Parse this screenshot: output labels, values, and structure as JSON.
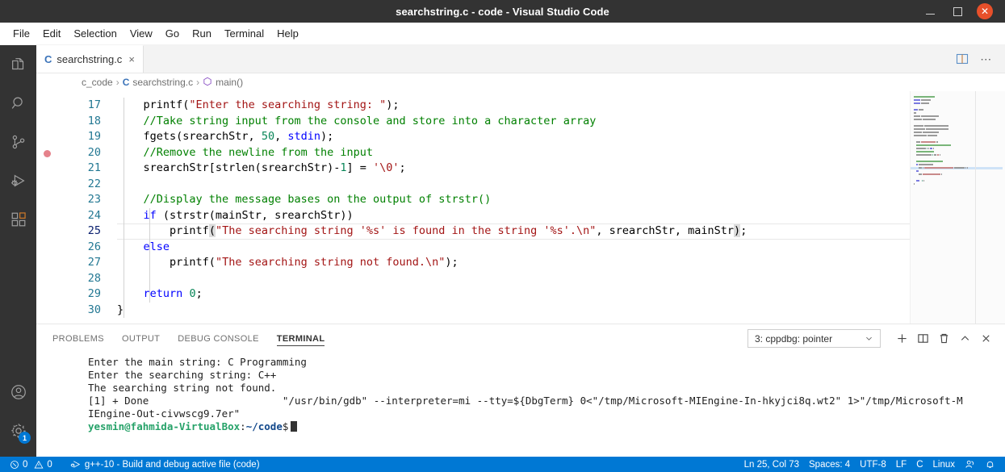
{
  "window": {
    "title": "searchstring.c - code - Visual Studio Code",
    "minimize_label": "Minimize",
    "maximize_label": "Maximize",
    "close_label": "Close"
  },
  "menubar": {
    "items": [
      "File",
      "Edit",
      "Selection",
      "View",
      "Go",
      "Run",
      "Terminal",
      "Help"
    ]
  },
  "activitybar": {
    "items": [
      {
        "name": "explorer",
        "title": "Explorer"
      },
      {
        "name": "search",
        "title": "Search"
      },
      {
        "name": "source-control",
        "title": "Source Control"
      },
      {
        "name": "run-debug",
        "title": "Run and Debug"
      },
      {
        "name": "extensions",
        "title": "Extensions"
      }
    ],
    "bottom": [
      {
        "name": "accounts",
        "title": "Accounts"
      },
      {
        "name": "settings",
        "title": "Manage",
        "badge": "1"
      }
    ]
  },
  "tabs": {
    "active": {
      "icon_letter": "C",
      "label": "searchstring.c",
      "close": "×"
    },
    "actions": [
      {
        "name": "split-editor-right",
        "title": "Split Editor Right"
      },
      {
        "name": "more-actions",
        "title": "More Actions..."
      }
    ]
  },
  "breadcrumb": {
    "folder": "c_code",
    "sep1": "›",
    "file_icon": "C",
    "file": "searchstring.c",
    "sep2": "›",
    "symbol": "main()"
  },
  "editor": {
    "first_line": 17,
    "breakpoint_line": 20,
    "current_line": 25,
    "lines": [
      {
        "n": 17,
        "tokens": [
          {
            "t": "    ",
            "c": ""
          },
          {
            "t": "printf(",
            "c": ""
          },
          {
            "t": "\"Enter the searching string: \"",
            "c": "str"
          },
          {
            "t": ");",
            "c": ""
          }
        ]
      },
      {
        "n": 18,
        "tokens": [
          {
            "t": "    ",
            "c": ""
          },
          {
            "t": "//Take string input from the console and store into a character array",
            "c": "cmt"
          }
        ]
      },
      {
        "n": 19,
        "tokens": [
          {
            "t": "    ",
            "c": ""
          },
          {
            "t": "fgets(srearchStr, ",
            "c": ""
          },
          {
            "t": "50",
            "c": "num"
          },
          {
            "t": ", ",
            "c": ""
          },
          {
            "t": "stdin",
            "c": "kw"
          },
          {
            "t": ");",
            "c": ""
          }
        ]
      },
      {
        "n": 20,
        "tokens": [
          {
            "t": "    ",
            "c": ""
          },
          {
            "t": "//Remove the newline from the input",
            "c": "cmt"
          }
        ]
      },
      {
        "n": 21,
        "tokens": [
          {
            "t": "    ",
            "c": ""
          },
          {
            "t": "srearchStr[strlen(srearchStr)-",
            "c": ""
          },
          {
            "t": "1",
            "c": "num"
          },
          {
            "t": "] = ",
            "c": ""
          },
          {
            "t": "'\\0'",
            "c": "str"
          },
          {
            "t": ";",
            "c": ""
          }
        ]
      },
      {
        "n": 22,
        "tokens": []
      },
      {
        "n": 23,
        "tokens": [
          {
            "t": "    ",
            "c": ""
          },
          {
            "t": "//Display the message bases on the output of strstr()",
            "c": "cmt"
          }
        ]
      },
      {
        "n": 24,
        "tokens": [
          {
            "t": "    ",
            "c": ""
          },
          {
            "t": "if",
            "c": "kw"
          },
          {
            "t": " (strstr(mainStr, srearchStr))",
            "c": ""
          }
        ]
      },
      {
        "n": 25,
        "tokens": [
          {
            "t": "        ",
            "c": ""
          },
          {
            "t": "printf",
            "c": ""
          },
          {
            "t": "(",
            "c": "bmatch"
          },
          {
            "t": "\"The searching string '%s' is found in the string '%s'.\\n\"",
            "c": "str"
          },
          {
            "t": ", srearchStr, mainStr",
            "c": ""
          },
          {
            "t": ")",
            "c": "bmatch"
          },
          {
            "t": ";",
            "c": ""
          }
        ]
      },
      {
        "n": 26,
        "tokens": [
          {
            "t": "    ",
            "c": ""
          },
          {
            "t": "else",
            "c": "kw"
          }
        ]
      },
      {
        "n": 27,
        "tokens": [
          {
            "t": "        ",
            "c": ""
          },
          {
            "t": "printf(",
            "c": ""
          },
          {
            "t": "\"The searching string not found.\\n\"",
            "c": "str"
          },
          {
            "t": ");",
            "c": ""
          }
        ]
      },
      {
        "n": 28,
        "tokens": []
      },
      {
        "n": 29,
        "tokens": [
          {
            "t": "    ",
            "c": ""
          },
          {
            "t": "return",
            "c": "kw"
          },
          {
            "t": " ",
            "c": ""
          },
          {
            "t": "0",
            "c": "num"
          },
          {
            "t": ";",
            "c": ""
          }
        ]
      },
      {
        "n": 30,
        "tokens": [
          {
            "t": "}",
            "c": ""
          }
        ]
      }
    ]
  },
  "panel": {
    "tabs": [
      {
        "label": "PROBLEMS",
        "active": false
      },
      {
        "label": "OUTPUT",
        "active": false
      },
      {
        "label": "DEBUG CONSOLE",
        "active": false
      },
      {
        "label": "TERMINAL",
        "active": true
      }
    ],
    "terminal_select": {
      "value": "3: cppdbg: pointer",
      "chevron": "∨"
    },
    "actions": [
      {
        "name": "new-terminal",
        "title": "New Terminal",
        "glyph": "+"
      },
      {
        "name": "split-terminal",
        "title": "Split Terminal"
      },
      {
        "name": "kill-terminal",
        "title": "Kill Terminal"
      },
      {
        "name": "maximize-panel",
        "title": "Maximize Panel Size"
      },
      {
        "name": "close-panel",
        "title": "Close Panel"
      }
    ]
  },
  "terminal": {
    "lines": [
      "Enter the main string: C Programming",
      "Enter the searching string: C++",
      "The searching string not found.",
      "[1] + Done                      \"/usr/bin/gdb\" --interpreter=mi --tty=${DbgTerm} 0<\"/tmp/Microsoft-MIEngine-In-hkyjci8q.wt2\" 1>\"/tmp/Microsoft-M",
      "IEngine-Out-civwscg9.7er\""
    ],
    "prompt": {
      "user_host": "yesmin@fahmida-VirtualBox",
      "colon": ":",
      "path": "~/code",
      "dollar": "$"
    }
  },
  "statusbar": {
    "errors_icon": "ⓧ",
    "errors": "0",
    "warnings_icon": "⚠",
    "warnings": "0",
    "build_task": "g++-10 - Build and debug active file (code)",
    "position": "Ln 25, Col 73",
    "indentation": "Spaces: 4",
    "encoding": "UTF-8",
    "eol": "LF",
    "language": "C",
    "platform": "Linux",
    "feedback_title": "Tweet Feedback",
    "notifications_title": "No Notifications"
  },
  "colors": {
    "accent": "#0078d4",
    "titlebar_bg": "#333333",
    "close_button": "#e8502a",
    "string": "#a31515",
    "comment": "#008000",
    "keyword": "#0000ff",
    "number": "#098658",
    "linenumber": "#237893",
    "breakpoint": "#e5828b",
    "terminal_user": "#26a269",
    "terminal_path": "#12488b"
  }
}
